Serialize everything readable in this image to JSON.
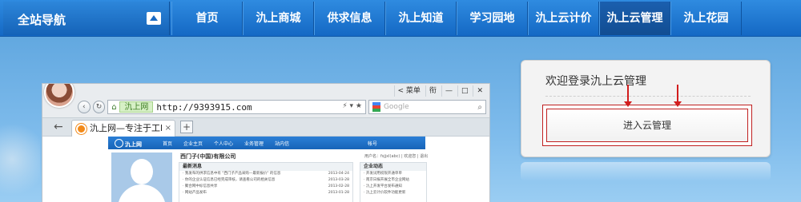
{
  "nav": {
    "site_nav_title": "全站导航",
    "items": [
      {
        "label": "首页"
      },
      {
        "label": "氿上商城"
      },
      {
        "label": "供求信息"
      },
      {
        "label": "氿上知道"
      },
      {
        "label": "学习园地"
      },
      {
        "label": "氿上云计价"
      },
      {
        "label": "氿上云管理",
        "active": true
      },
      {
        "label": "氿上花园"
      }
    ]
  },
  "browser": {
    "window_controls": [
      "< 菜单",
      "衔",
      "—",
      "□",
      "✕"
    ],
    "address": {
      "site_tag": "氿上网",
      "url": "http://9393915.com",
      "search_placeholder": "Google"
    },
    "tab": {
      "title": "氿上网—专注于工l",
      "close": "×",
      "new_tab": "+"
    },
    "page": {
      "logo": "氿上网",
      "nav": [
        "首页",
        "企业主页",
        "个人中心",
        "业务管理",
        "站内信"
      ],
      "right_nav": "帐号",
      "company": "西门子(中国)有限公司",
      "user_line": "用户名：fsjjxl(abc)  | 欢迎您 | 退出",
      "news_title": "最新消息",
      "news_rows": [
        {
          "text": "· 我发布的供求信息中有 \"西门子产品采购—最新报价\" 的信息",
          "date": "2013-04-24"
        },
        {
          "text": "· 你的企业认证信息已经完成审核，请查看公司的相关信息",
          "date": "2013-03-28"
        },
        {
          "text": "· 聚合网中标信息共享",
          "date": "2013-02-28"
        },
        {
          "text": "· 网站产品发布",
          "date": "2013-01-28"
        }
      ],
      "dyn_title": "企业动态",
      "dyn_rows": [
        "· 开发试用权限开通单单",
        "· 南京日报开展全市企业网站",
        "· 氿上开发平台发布通知",
        "· 氿上云计价软件功能更新"
      ]
    }
  },
  "login": {
    "welcome": "欢迎登录氿上云管理",
    "enter_button": "进入云管理"
  }
}
